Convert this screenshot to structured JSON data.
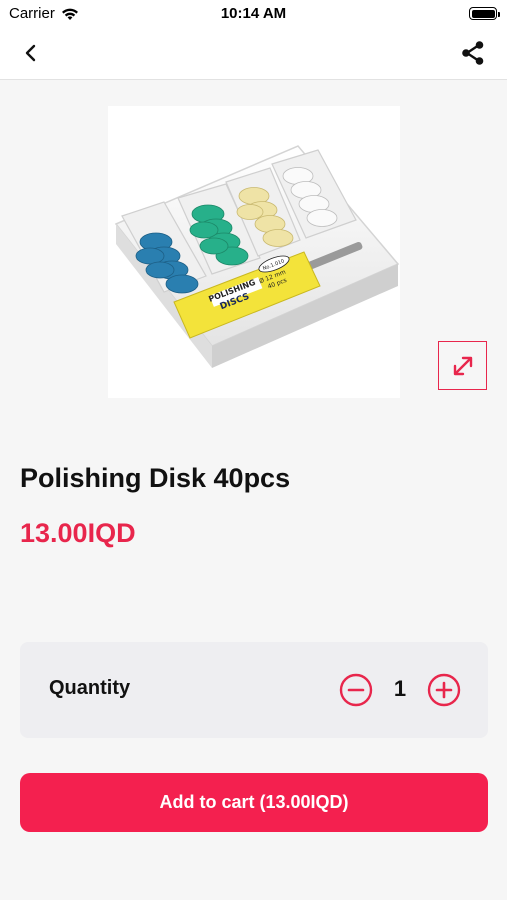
{
  "status_bar": {
    "carrier": "Carrier",
    "time": "10:14 AM",
    "icons": [
      "wifi-icon",
      "battery-icon"
    ]
  },
  "nav": {
    "back_icon": "chevron-left-icon",
    "share_icon": "share-icon"
  },
  "product": {
    "image_alt": "Polishing discs kit in white tray",
    "image_label_brand": "POLISHING",
    "image_label_product": "DISCS",
    "image_label_size": "Ø 12 mm",
    "image_label_count": "40 pcs",
    "image_label_no": "No.1.010",
    "title": "Polishing Disk 40pcs",
    "price": "13.00IQD"
  },
  "quantity": {
    "label": "Quantity",
    "value": "1"
  },
  "cart": {
    "button_label": "Add to cart (13.00IQD)"
  },
  "colors": {
    "accent": "#e8264c",
    "button": "#f4204f",
    "panel": "#eeeef1",
    "background": "#f6f6f6"
  }
}
